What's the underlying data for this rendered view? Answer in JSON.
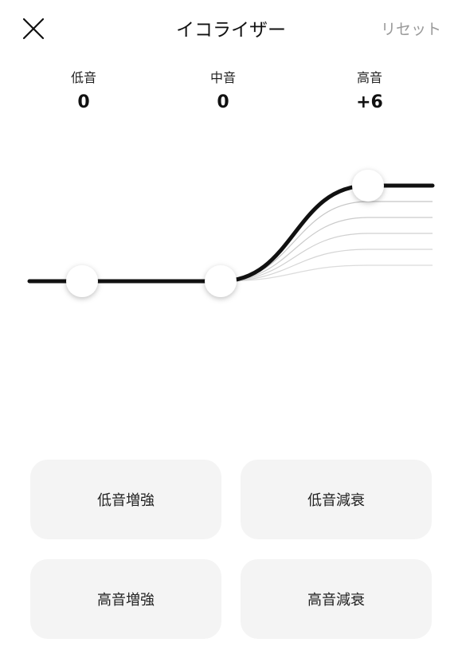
{
  "header": {
    "title": "イコライザー",
    "reset_label": "リセット"
  },
  "bands": [
    {
      "label": "低音",
      "value": "0"
    },
    {
      "label": "中音",
      "value": "0"
    },
    {
      "label": "高音",
      "value": "+6"
    }
  ],
  "eq": {
    "levels": [
      0,
      0,
      6
    ],
    "preview_levels": [
      1,
      2,
      3,
      4,
      5
    ],
    "max_level": 6
  },
  "presets": [
    "低音増強",
    "低音減衰",
    "高音増強",
    "高音減衰"
  ],
  "colors": {
    "curve": "#111111",
    "preview_curve": "#bdbdbd",
    "reset_text": "#9a9a9a",
    "preset_bg": "#f4f4f4"
  }
}
